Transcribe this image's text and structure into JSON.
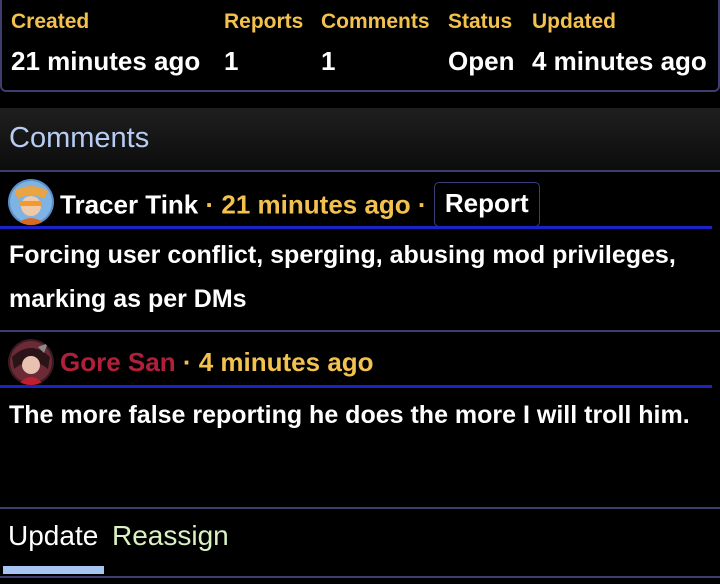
{
  "summary": {
    "created": {
      "label": "Created",
      "value": "21 minutes ago"
    },
    "reports": {
      "label": "Reports",
      "value": "1"
    },
    "comments": {
      "label": "Comments",
      "value": "1"
    },
    "status": {
      "label": "Status",
      "value": "Open"
    },
    "updated": {
      "label": "Updated",
      "value": "4 minutes ago"
    }
  },
  "comments_section": {
    "title": "Comments",
    "items": [
      {
        "author": "Tracer Tink",
        "separator": "·",
        "time": "21 minutes ago",
        "report_label": "Report",
        "text": "Forcing user conflict, sperging, abusing mod privileges, marking as per DMs",
        "avatar_icon": "avatar-tracer-icon"
      },
      {
        "author": "Gore San",
        "separator": "·",
        "time": "4 minutes ago",
        "text": "The more false reporting he does the more I will troll him.",
        "avatar_icon": "avatar-gore-icon"
      }
    ]
  },
  "tabs": {
    "update": "Update",
    "reassign": "Reassign"
  },
  "colors": {
    "header_label": "#f2c14e",
    "comments_title": "#b7cdf5",
    "author_red": "#b0203a",
    "rule_blue": "#1a22c8",
    "border_purple": "#3e3d6e"
  }
}
